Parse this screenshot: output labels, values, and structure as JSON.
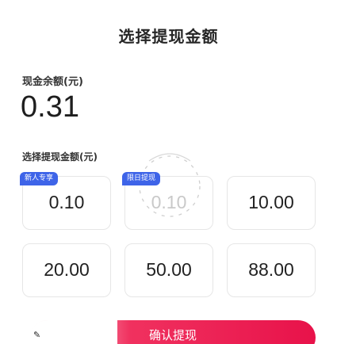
{
  "page": {
    "title": "选择提现金额"
  },
  "balance": {
    "label": "现金余额(元)",
    "amount": "0.31"
  },
  "selection": {
    "label": "选择提现金额(元)",
    "options": [
      {
        "amount": "0.10",
        "badge": "新人专享"
      },
      {
        "amount": "0.10",
        "badge": "限日提现"
      },
      {
        "amount": "10.00",
        "badge": ""
      },
      {
        "amount": "20.00",
        "badge": ""
      },
      {
        "amount": "50.00",
        "badge": ""
      },
      {
        "amount": "88.00",
        "badge": ""
      }
    ]
  },
  "confirm": {
    "label": "确认提现"
  },
  "colors": {
    "badge": "#3e64e8",
    "accent": "#e8124a"
  }
}
